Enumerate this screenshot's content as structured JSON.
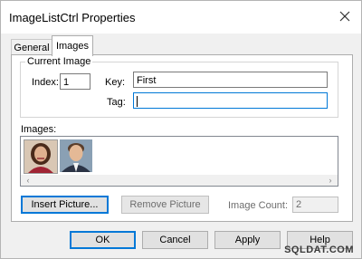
{
  "window": {
    "title": "ImageListCtrl Properties",
    "close_icon": "close-icon"
  },
  "tabs": [
    {
      "label": "General",
      "selected": false
    },
    {
      "label": "Images",
      "selected": true
    }
  ],
  "current_image": {
    "group_label": "Current Image",
    "index_label": "Index:",
    "index_value": "1",
    "key_label": "Key:",
    "key_value": "First",
    "tag_label": "Tag:",
    "tag_value": ""
  },
  "images_list": {
    "label": "Images:",
    "items": [
      {
        "name": "portrait-woman"
      },
      {
        "name": "portrait-man"
      }
    ],
    "scroll_left_icon": "chevron-left-icon",
    "scroll_right_icon": "chevron-right-icon"
  },
  "actions": {
    "insert_picture": "Insert Picture...",
    "remove_picture": "Remove Picture",
    "image_count_label": "Image Count:",
    "image_count_value": "2"
  },
  "footer": {
    "ok": "OK",
    "cancel": "Cancel",
    "apply": "Apply",
    "help": "Help"
  },
  "watermark": "SQLDAT.COM"
}
